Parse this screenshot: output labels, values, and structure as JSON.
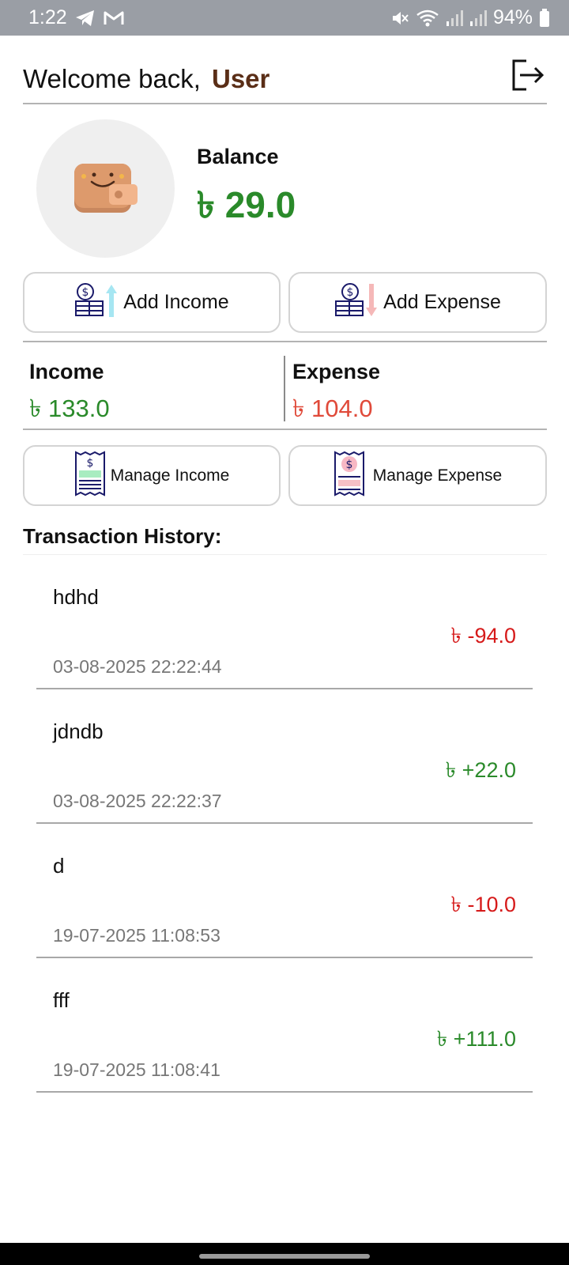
{
  "status_bar": {
    "time": "1:22",
    "battery": "94%"
  },
  "header": {
    "welcome": "Welcome back,",
    "user": "User"
  },
  "balance": {
    "label": "Balance",
    "value": "৳ 29.0"
  },
  "actions": {
    "add_income": "Add Income",
    "add_expense": "Add Expense"
  },
  "summary": {
    "income_label": "Income",
    "income_value": "৳ 133.0",
    "expense_label": "Expense",
    "expense_value": "৳ 104.0"
  },
  "manage": {
    "income": "Manage Income",
    "expense": "Manage Expense"
  },
  "history": {
    "title": "Transaction History:",
    "items": [
      {
        "name": "hdhd",
        "amount": "৳ -94.0",
        "date": "03-08-2025 22:22:44"
      },
      {
        "name": "jdndb",
        "amount": "৳ +22.0",
        "date": "03-08-2025 22:22:37"
      },
      {
        "name": "d",
        "amount": "৳ -10.0",
        "date": "19-07-2025 11:08:53"
      },
      {
        "name": "fff",
        "amount": "৳ +111.0",
        "date": "19-07-2025 11:08:41"
      }
    ]
  },
  "colors": {
    "positive": "#2a8a2a",
    "negative": "#d61a1a",
    "expense_total": "#e04a3a",
    "user_name": "#5a2e17"
  },
  "icons": {
    "status_left": [
      "telegram-icon",
      "gmail-icon"
    ],
    "status_right": [
      "mute-icon",
      "wifi-icon",
      "signal-icon",
      "battery-icon"
    ],
    "logout": "logout-icon",
    "wallet": "wallet-icon"
  }
}
